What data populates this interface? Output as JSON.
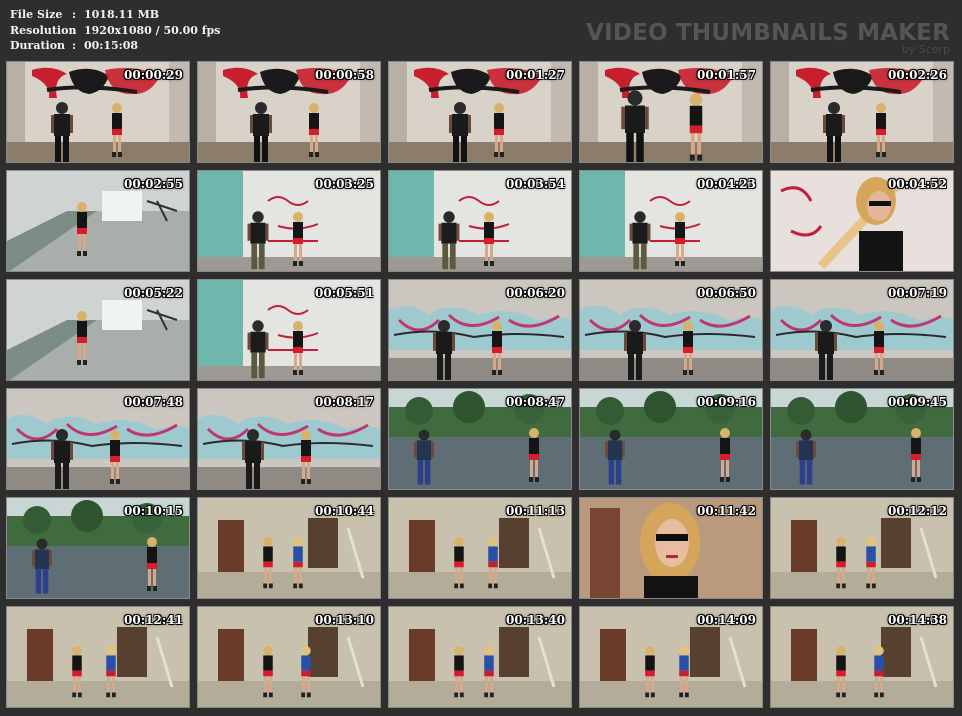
{
  "info": {
    "file_size_label": "File Size",
    "file_size": "1018.11 MB",
    "resolution_label": "Resolution",
    "resolution": "1920x1080 / 50.00 fps",
    "duration_label": "Duration",
    "duration": "00:15:08",
    "separator": ":"
  },
  "brand": {
    "title": "VIDEO THUMBNAILS MAKER",
    "subtitle": "by Scorp"
  },
  "thumbnails": [
    {
      "time": "00:00:29",
      "scene": "graffiti-red"
    },
    {
      "time": "00:00:58",
      "scene": "graffiti-red"
    },
    {
      "time": "00:01:27",
      "scene": "graffiti-red"
    },
    {
      "time": "00:01:57",
      "scene": "graffiti-red"
    },
    {
      "time": "00:02:26",
      "scene": "graffiti-red"
    },
    {
      "time": "00:02:55",
      "scene": "stairs"
    },
    {
      "time": "00:03:25",
      "scene": "teal-wall"
    },
    {
      "time": "00:03:54",
      "scene": "teal-wall"
    },
    {
      "time": "00:04:23",
      "scene": "teal-wall"
    },
    {
      "time": "00:04:52",
      "scene": "closeup-bat"
    },
    {
      "time": "00:05:22",
      "scene": "stairs"
    },
    {
      "time": "00:05:51",
      "scene": "teal-wall"
    },
    {
      "time": "00:06:20",
      "scene": "brick-graffiti"
    },
    {
      "time": "00:06:50",
      "scene": "brick-graffiti"
    },
    {
      "time": "00:07:19",
      "scene": "brick-graffiti"
    },
    {
      "time": "00:07:48",
      "scene": "brick-graffiti"
    },
    {
      "time": "00:08:17",
      "scene": "brick-graffiti"
    },
    {
      "time": "00:08:47",
      "scene": "rooftop"
    },
    {
      "time": "00:09:16",
      "scene": "rooftop"
    },
    {
      "time": "00:09:45",
      "scene": "rooftop"
    },
    {
      "time": "00:10:15",
      "scene": "rooftop"
    },
    {
      "time": "00:10:44",
      "scene": "room"
    },
    {
      "time": "00:11:13",
      "scene": "room"
    },
    {
      "time": "00:11:42",
      "scene": "closeup-face"
    },
    {
      "time": "00:12:12",
      "scene": "room"
    },
    {
      "time": "00:12:41",
      "scene": "room"
    },
    {
      "time": "00:13:10",
      "scene": "room"
    },
    {
      "time": "00:13:40",
      "scene": "room"
    },
    {
      "time": "00:14:09",
      "scene": "room"
    },
    {
      "time": "00:14:38",
      "scene": "room"
    }
  ],
  "colors": {
    "background": "#2e2e2e",
    "text": "#f2f2f2",
    "brand": "#555555",
    "thumb_border": "#8a8a8a"
  }
}
